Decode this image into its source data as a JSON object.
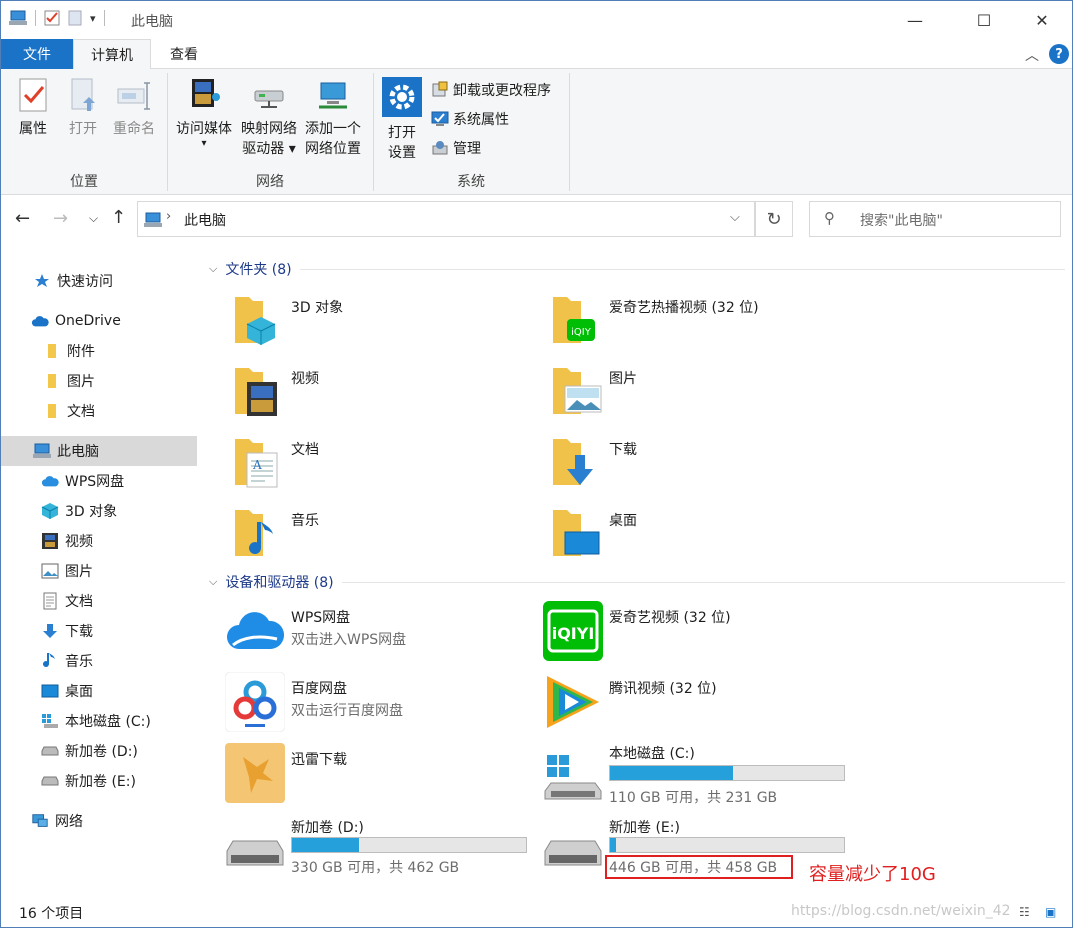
{
  "window": {
    "title": "此电脑",
    "controls": {
      "minimize": "—",
      "maximize": "☐",
      "close": "✕"
    }
  },
  "ribbon_tabs": [
    {
      "label": "文件"
    },
    {
      "label": "计算机"
    },
    {
      "label": "查看"
    }
  ],
  "ribbon": {
    "groups": {
      "location": {
        "label": "位置",
        "buttons": [
          {
            "label": "属性"
          },
          {
            "label": "打开"
          },
          {
            "label": "重命名"
          }
        ]
      },
      "network": {
        "label": "网络",
        "buttons": [
          {
            "line1": "访问媒体",
            "line2": "▾"
          },
          {
            "line1": "映射网络",
            "line2": "驱动器 ▾"
          },
          {
            "line1": "添加一个",
            "line2": "网络位置"
          }
        ]
      },
      "system": {
        "label": "系统",
        "open_settings": {
          "line1": "打开",
          "line2": "设置"
        },
        "small_buttons": [
          {
            "label": "卸载或更改程序"
          },
          {
            "label": "系统属性"
          },
          {
            "label": "管理"
          }
        ]
      }
    }
  },
  "address": {
    "path": "此电脑",
    "search_placeholder": "搜索\"此电脑\""
  },
  "nav": [
    {
      "label": "快速访问",
      "icon": "star-icon"
    },
    {
      "label": "OneDrive",
      "icon": "cloud-icon"
    },
    {
      "label": "附件",
      "icon": "folder-icon"
    },
    {
      "label": "图片",
      "icon": "folder-icon"
    },
    {
      "label": "文档",
      "icon": "folder-icon"
    },
    {
      "label": "此电脑",
      "icon": "computer-icon",
      "selected": true
    },
    {
      "label": "WPS网盘",
      "icon": "wps-cloud-icon"
    },
    {
      "label": "3D 对象",
      "icon": "cube-icon"
    },
    {
      "label": "视频",
      "icon": "video-icon"
    },
    {
      "label": "图片",
      "icon": "picture-icon"
    },
    {
      "label": "文档",
      "icon": "document-icon"
    },
    {
      "label": "下载",
      "icon": "download-icon"
    },
    {
      "label": "音乐",
      "icon": "music-icon"
    },
    {
      "label": "桌面",
      "icon": "desktop-icon"
    },
    {
      "label": "本地磁盘 (C:)",
      "icon": "drive-c-icon"
    },
    {
      "label": "新加卷 (D:)",
      "icon": "drive-icon"
    },
    {
      "label": "新加卷 (E:)",
      "icon": "drive-icon"
    },
    {
      "label": "网络",
      "icon": "network-icon"
    }
  ],
  "folders_section": {
    "header": "文件夹 (8)",
    "items": [
      {
        "name": "3D 对象"
      },
      {
        "name": "爱奇艺热播视频 (32 位)"
      },
      {
        "name": "视频"
      },
      {
        "name": "图片"
      },
      {
        "name": "文档"
      },
      {
        "name": "下载"
      },
      {
        "name": "音乐"
      },
      {
        "name": "桌面"
      }
    ]
  },
  "devices_section": {
    "header": "设备和驱动器 (8)",
    "items": [
      {
        "name": "WPS网盘",
        "sub": "双击进入WPS网盘"
      },
      {
        "name": "爱奇艺视频 (32 位)"
      },
      {
        "name": "百度网盘",
        "sub": "双击运行百度网盘"
      },
      {
        "name": "腾讯视频 (32 位)"
      },
      {
        "name": "迅雷下载"
      },
      {
        "name": "本地磁盘 (C:)",
        "sub": "110 GB 可用，共 231 GB",
        "used_fraction": 0.524
      },
      {
        "name": "新加卷 (D:)",
        "sub": "330 GB 可用，共 462 GB",
        "used_fraction": 0.286
      },
      {
        "name": "新加卷 (E:)",
        "sub": "446 GB 可用，共 458 GB",
        "used_fraction": 0.026
      }
    ]
  },
  "annotation": "容量减少了10G",
  "status": "16 个项目",
  "watermark": "https://blog.csdn.net/weixin_42",
  "colors": {
    "accent": "#1a73c7",
    "bar_fill": "#26a0da",
    "annotation": "#e02020"
  }
}
